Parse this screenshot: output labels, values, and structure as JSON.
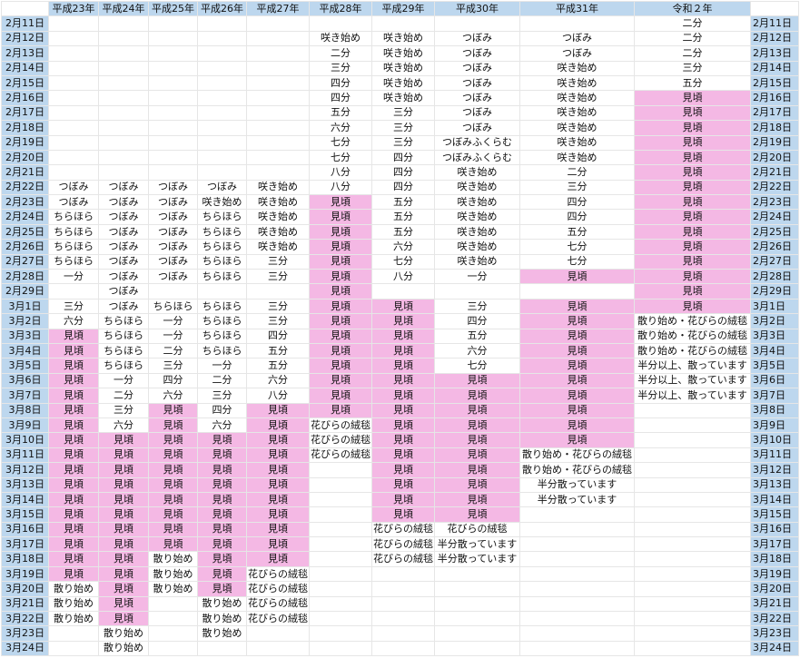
{
  "years": [
    "平成23年",
    "平成24年",
    "平成25年",
    "平成26年",
    "平成27年",
    "平成28年",
    "平成29年",
    "平成30年",
    "平成31年",
    "令和２年"
  ],
  "peak_label": "見頃",
  "highlight_color": "#f4b8e4",
  "header_color": "#bdd7ee",
  "dates": [
    "2月11日",
    "2月12日",
    "2月13日",
    "2月14日",
    "2月15日",
    "2月16日",
    "2月17日",
    "2月18日",
    "2月19日",
    "2月20日",
    "2月21日",
    "2月22日",
    "2月23日",
    "2月24日",
    "2月25日",
    "2月26日",
    "2月27日",
    "2月28日",
    "2月29日",
    "3月1日",
    "3月2日",
    "3月3日",
    "3月4日",
    "3月5日",
    "3月6日",
    "3月7日",
    "3月8日",
    "3月9日",
    "3月10日",
    "3月11日",
    "3月12日",
    "3月13日",
    "3月14日",
    "3月15日",
    "3月16日",
    "3月17日",
    "3月18日",
    "3月19日",
    "3月20日",
    "3月21日",
    "3月22日",
    "3月23日",
    "3月24日"
  ],
  "rows": [
    [
      "",
      "",
      "",
      "",
      "",
      "",
      "",
      "",
      "",
      "二分"
    ],
    [
      "",
      "",
      "",
      "",
      "",
      "咲き始め",
      "咲き始め",
      "つぼみ",
      "つぼみ",
      "二分"
    ],
    [
      "",
      "",
      "",
      "",
      "",
      "二分",
      "咲き始め",
      "つぼみ",
      "つぼみ",
      "二分"
    ],
    [
      "",
      "",
      "",
      "",
      "",
      "三分",
      "咲き始め",
      "つぼみ",
      "咲き始め",
      "三分"
    ],
    [
      "",
      "",
      "",
      "",
      "",
      "四分",
      "咲き始め",
      "つぼみ",
      "咲き始め",
      "五分"
    ],
    [
      "",
      "",
      "",
      "",
      "",
      "四分",
      "咲き始め",
      "つぼみ",
      "咲き始め",
      "見頃"
    ],
    [
      "",
      "",
      "",
      "",
      "",
      "五分",
      "三分",
      "つぼみ",
      "咲き始め",
      "見頃"
    ],
    [
      "",
      "",
      "",
      "",
      "",
      "六分",
      "三分",
      "つぼみ",
      "咲き始め",
      "見頃"
    ],
    [
      "",
      "",
      "",
      "",
      "",
      "七分",
      "三分",
      "つぼみふくらむ",
      "咲き始め",
      "見頃"
    ],
    [
      "",
      "",
      "",
      "",
      "",
      "七分",
      "四分",
      "つぼみふくらむ",
      "咲き始め",
      "見頃"
    ],
    [
      "",
      "",
      "",
      "",
      "",
      "八分",
      "四分",
      "咲き始め",
      "二分",
      "見頃"
    ],
    [
      "つぼみ",
      "つぼみ",
      "つぼみ",
      "つぼみ",
      "咲き始め",
      "八分",
      "四分",
      "咲き始め",
      "三分",
      "見頃"
    ],
    [
      "つぼみ",
      "つぼみ",
      "つぼみ",
      "咲き始め",
      "咲き始め",
      "見頃",
      "五分",
      "咲き始め",
      "四分",
      "見頃"
    ],
    [
      "ちらほら",
      "つぼみ",
      "つぼみ",
      "ちらほら",
      "咲き始め",
      "見頃",
      "五分",
      "咲き始め",
      "四分",
      "見頃"
    ],
    [
      "ちらほら",
      "つぼみ",
      "つぼみ",
      "ちらほら",
      "咲き始め",
      "見頃",
      "五分",
      "咲き始め",
      "五分",
      "見頃"
    ],
    [
      "ちらほら",
      "つぼみ",
      "つぼみ",
      "ちらほら",
      "咲き始め",
      "見頃",
      "六分",
      "咲き始め",
      "七分",
      "見頃"
    ],
    [
      "ちらほら",
      "つぼみ",
      "つぼみ",
      "ちらほら",
      "三分",
      "見頃",
      "七分",
      "咲き始め",
      "七分",
      "見頃"
    ],
    [
      "一分",
      "つぼみ",
      "つぼみ",
      "ちらほら",
      "三分",
      "見頃",
      "八分",
      "一分",
      "見頃",
      "見頃"
    ],
    [
      "",
      "つぼみ",
      "",
      "",
      "",
      "見頃",
      "",
      "",
      "",
      "見頃"
    ],
    [
      "三分",
      "つぼみ",
      "ちらほら",
      "ちらほら",
      "三分",
      "見頃",
      "見頃",
      "三分",
      "見頃",
      "見頃"
    ],
    [
      "六分",
      "ちらほら",
      "一分",
      "ちらほら",
      "三分",
      "見頃",
      "見頃",
      "四分",
      "見頃",
      "散り始め・花びらの絨毯"
    ],
    [
      "見頃",
      "ちらほら",
      "一分",
      "ちらほら",
      "四分",
      "見頃",
      "見頃",
      "五分",
      "見頃",
      "散り始め・花びらの絨毯"
    ],
    [
      "見頃",
      "ちらほら",
      "二分",
      "ちらほら",
      "五分",
      "見頃",
      "見頃",
      "六分",
      "見頃",
      "散り始め・花びらの絨毯"
    ],
    [
      "見頃",
      "ちらほら",
      "三分",
      "一分",
      "五分",
      "見頃",
      "見頃",
      "七分",
      "見頃",
      "半分以上、散っています"
    ],
    [
      "見頃",
      "一分",
      "四分",
      "二分",
      "六分",
      "見頃",
      "見頃",
      "見頃",
      "見頃",
      "半分以上、散っています"
    ],
    [
      "見頃",
      "二分",
      "六分",
      "三分",
      "八分",
      "見頃",
      "見頃",
      "見頃",
      "見頃",
      "半分以上、散っています"
    ],
    [
      "見頃",
      "三分",
      "見頃",
      "四分",
      "見頃",
      "見頃",
      "見頃",
      "見頃",
      "見頃",
      ""
    ],
    [
      "見頃",
      "六分",
      "見頃",
      "六分",
      "見頃",
      "花びらの絨毯",
      "見頃",
      "見頃",
      "見頃",
      ""
    ],
    [
      "見頃",
      "見頃",
      "見頃",
      "見頃",
      "見頃",
      "花びらの絨毯",
      "見頃",
      "見頃",
      "見頃",
      ""
    ],
    [
      "見頃",
      "見頃",
      "見頃",
      "見頃",
      "見頃",
      "花びらの絨毯",
      "見頃",
      "見頃",
      "散り始め・花びらの絨毯",
      ""
    ],
    [
      "見頃",
      "見頃",
      "見頃",
      "見頃",
      "見頃",
      "",
      "見頃",
      "見頃",
      "散り始め・花びらの絨毯",
      ""
    ],
    [
      "見頃",
      "見頃",
      "見頃",
      "見頃",
      "見頃",
      "",
      "見頃",
      "見頃",
      "半分散っています",
      ""
    ],
    [
      "見頃",
      "見頃",
      "見頃",
      "見頃",
      "見頃",
      "",
      "見頃",
      "見頃",
      "半分散っています",
      ""
    ],
    [
      "見頃",
      "見頃",
      "見頃",
      "見頃",
      "見頃",
      "",
      "見頃",
      "見頃",
      "",
      ""
    ],
    [
      "見頃",
      "見頃",
      "見頃",
      "見頃",
      "見頃",
      "",
      "花びらの絨毯",
      "花びらの絨毯",
      "",
      ""
    ],
    [
      "見頃",
      "見頃",
      "見頃",
      "見頃",
      "見頃",
      "",
      "花びらの絨毯",
      "半分散っています",
      "",
      ""
    ],
    [
      "見頃",
      "見頃",
      "散り始め",
      "見頃",
      "見頃",
      "",
      "花びらの絨毯",
      "半分散っています",
      "",
      ""
    ],
    [
      "見頃",
      "見頃",
      "散り始め",
      "見頃",
      "花びらの絨毯",
      "",
      "",
      "",
      "",
      ""
    ],
    [
      "散り始め",
      "見頃",
      "散り始め",
      "見頃",
      "花びらの絨毯",
      "",
      "",
      "",
      "",
      ""
    ],
    [
      "散り始め",
      "見頃",
      "",
      "散り始め",
      "花びらの絨毯",
      "",
      "",
      "",
      "",
      ""
    ],
    [
      "散り始め",
      "見頃",
      "",
      "散り始め",
      "花びらの絨毯",
      "",
      "",
      "",
      "",
      ""
    ],
    [
      "",
      "散り始め",
      "",
      "散り始め",
      "",
      "",
      "",
      "",
      "",
      ""
    ],
    [
      "",
      "散り始め",
      "",
      "",
      "",
      "",
      "",
      "",
      "",
      ""
    ]
  ]
}
